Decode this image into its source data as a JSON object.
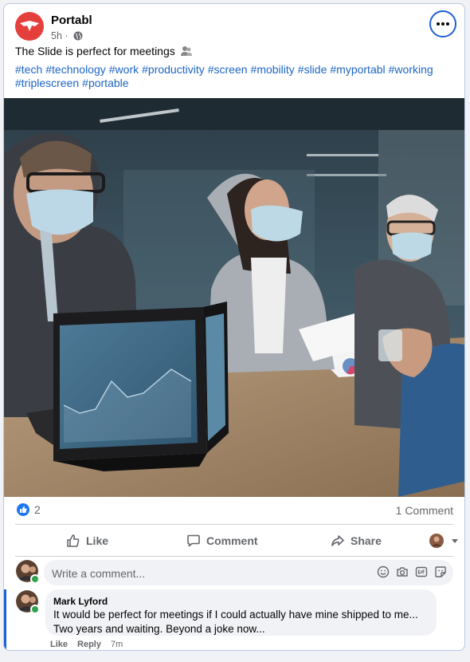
{
  "post": {
    "page_name": "Portabl",
    "time": "5h ·",
    "caption": "The Slide is perfect for meetings",
    "hashtags": [
      "#tech",
      "#technology",
      "#work",
      "#productivity",
      "#screen",
      "#mobility",
      "#slide",
      "#myportabl",
      "#working",
      "#triplescreen",
      "#portable"
    ],
    "reaction_count": "2",
    "comment_count": "1 Comment"
  },
  "actions": {
    "like": "Like",
    "comment": "Comment",
    "share": "Share"
  },
  "composer": {
    "placeholder": "Write a comment..."
  },
  "comment": {
    "author": "Mark Lyford",
    "text": "It would be perfect for meetings if I could actually have mine shipped to me...\nTwo years and waiting. Beyond a joke now...",
    "like": "Like",
    "reply": "Reply",
    "time": "7m"
  },
  "colors": {
    "brand": "#e53f3c",
    "link": "#1d65c5",
    "accent": "#1d5fd6"
  },
  "icons": [
    "portabl-logo",
    "globe-icon",
    "more-options-icon",
    "like-reaction-icon",
    "like-icon",
    "comment-icon",
    "share-icon",
    "smiley-icon",
    "camera-icon",
    "gif-icon",
    "sticker-icon"
  ]
}
